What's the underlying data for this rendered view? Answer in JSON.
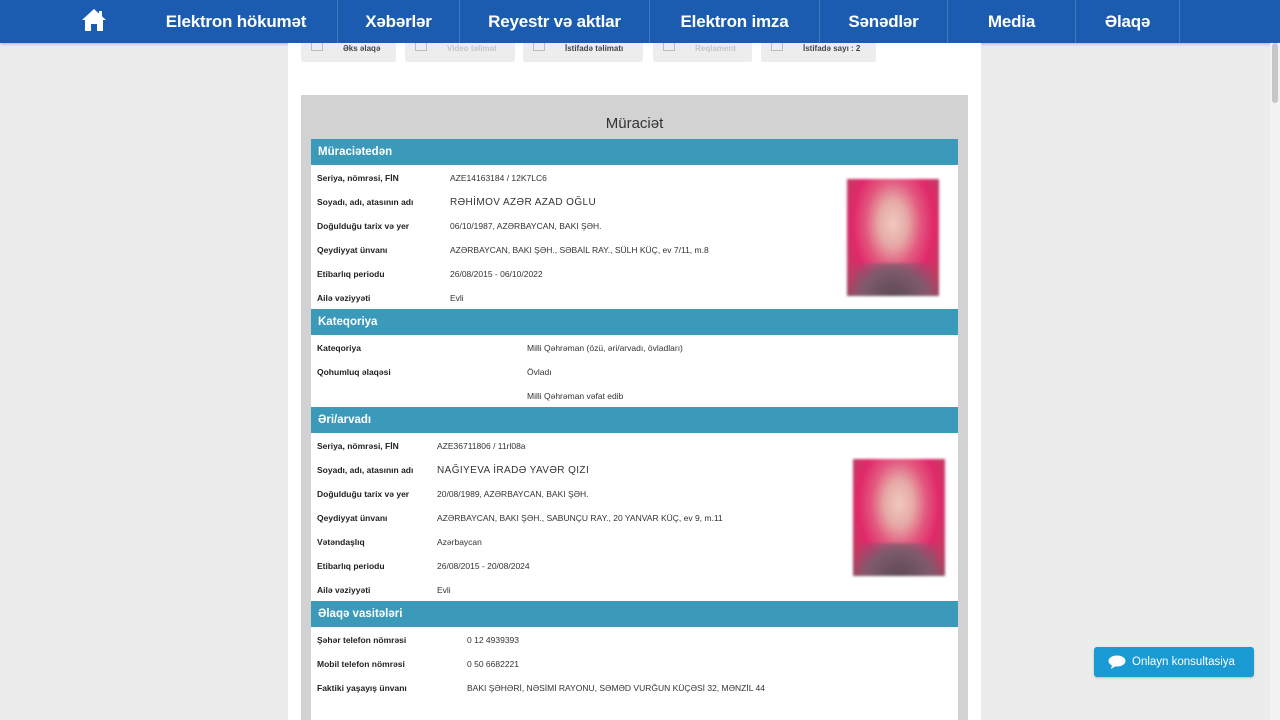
{
  "nav": {
    "items": [
      "Elektron hökumət",
      "Xəbərlər",
      "Reyestr və aktlar",
      "Elektron imza",
      "Sənədlər",
      "Media",
      "Əlaqə"
    ]
  },
  "toolbar": {
    "buttons": [
      "Əks əlaqə",
      "Video təlimat",
      "İstifadə təlimatı",
      "Reqlament",
      "İstifadə sayı : 2"
    ]
  },
  "form": {
    "title": "Müraciət",
    "applicant": {
      "heading": "Müraciətedən",
      "rows": [
        {
          "label": "Seriya, nömrəsi, FİN",
          "value": "AZE14163184 / 12K7LC6"
        },
        {
          "label": "Soyadı, adı, atasının adı",
          "value": "RƏHİMOV AZƏR AZAD OĞLU"
        },
        {
          "label": "Doğulduğu tarix və yer",
          "value": "06/10/1987, AZƏRBAYCAN, BAKI ŞƏH."
        },
        {
          "label": "Qeydiyyat ünvanı",
          "value": "AZƏRBAYCAN, BAKI ŞƏH., SƏBAİL RAY., SÜLH KÜÇ, ev 7/11, m.8"
        },
        {
          "label": "Etibarlıq periodu",
          "value": "26/08/2015 - 06/10/2022"
        },
        {
          "label": "Ailə vəziyyəti",
          "value": "Evli"
        }
      ]
    },
    "category": {
      "heading": "Kateqoriya",
      "rows": [
        {
          "label": "Kateqoriya",
          "value": "Milli Qəhrəman (özü, əri/arvadı, övladları)"
        },
        {
          "label": "Qohumluq əlaqəsi",
          "value": "Övladı"
        },
        {
          "label": "",
          "value": "Milli Qəhrəman vəfat edib"
        }
      ]
    },
    "spouse": {
      "heading": "Əri/arvadı",
      "rows": [
        {
          "label": "Seriya, nömrəsi, FİN",
          "value": "AZE36711806 / 11rl08a"
        },
        {
          "label": "Soyadı, adı, atasının adı",
          "value": "NAĞIYEVA İRADƏ YAVƏR QIZI"
        },
        {
          "label": "Doğulduğu tarix və yer",
          "value": "20/08/1989, AZƏRBAYCAN, BAKI ŞƏH."
        },
        {
          "label": "Qeydiyyat ünvanı",
          "value": "AZƏRBAYCAN, BAKI ŞƏH., SABUNÇU RAY., 20 YANVAR KÜÇ, ev 9, m.11"
        },
        {
          "label": "Vətəndaşlıq",
          "value": "Azərbaycan"
        },
        {
          "label": "Etibarlıq periodu",
          "value": "26/08/2015 - 20/08/2024"
        },
        {
          "label": "Ailə vəziyyəti",
          "value": "Evli"
        }
      ]
    },
    "contacts": {
      "heading": "Əlaqə vasitələri",
      "rows": [
        {
          "label": "Şəhər telefon nömrəsi",
          "value": "0 12 4939393"
        },
        {
          "label": "Mobil telefon nömrəsi",
          "value": "0 50 6682221"
        },
        {
          "label": "Faktiki yaşayış ünvanı",
          "value": "BAKI ŞƏHƏRİ, NƏSİMİ RAYONU, SƏMƏD VURĞUN KÜÇƏSİ 32, MƏNZİL 44"
        }
      ]
    }
  },
  "chat": {
    "label": "Onlayn konsultasiya"
  },
  "colors": {
    "nav": "#1b5cb0",
    "section": "#3b9ab9",
    "chat": "#199ad3"
  }
}
